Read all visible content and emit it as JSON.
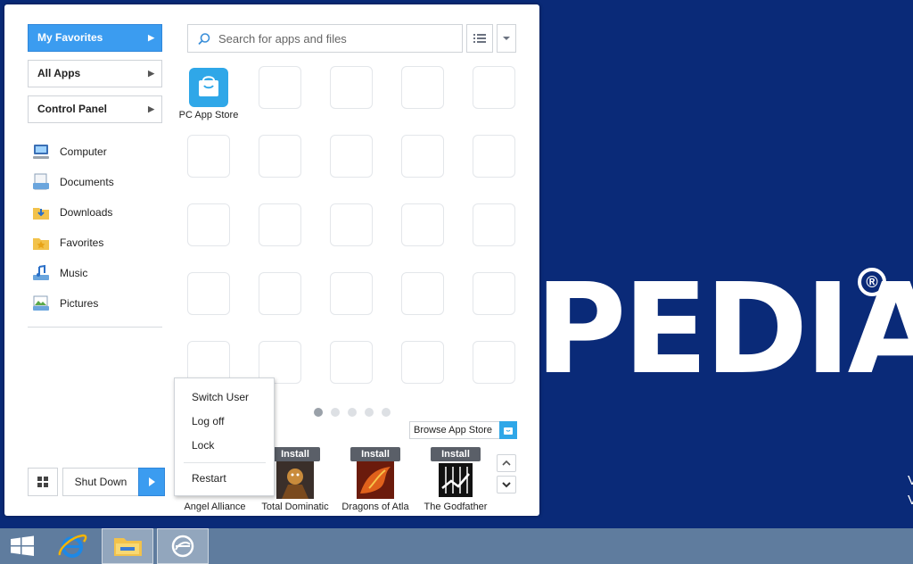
{
  "nav": {
    "favorites": "My Favorites",
    "all_apps": "All Apps",
    "control_panel": "Control Panel"
  },
  "places": [
    "Computer",
    "Documents",
    "Downloads",
    "Favorites",
    "Music",
    "Pictures"
  ],
  "search": {
    "placeholder": "Search for apps and files"
  },
  "apps": {
    "pc_app_store": "PC App Store"
  },
  "browse_store": "Browse App Store",
  "pager": {
    "pages": 5,
    "current": 1
  },
  "games": [
    {
      "name": "Angel Alliance",
      "install": ""
    },
    {
      "name": "Total Dominatic",
      "install": "Install"
    },
    {
      "name": "Dragons of Atla",
      "install": "Install"
    },
    {
      "name": "The Godfather",
      "install": "Install"
    }
  ],
  "power": {
    "shut_down": "Shut Down"
  },
  "power_menu": {
    "switch_user": "Switch User",
    "log_off": "Log off",
    "lock": "Lock",
    "restart": "Restart"
  },
  "wallpaper": {
    "text": "PEDIA",
    "trademark": "®"
  },
  "colors": {
    "accent": "#3b9cf0",
    "desktop": "#0a2a78",
    "taskbar": "#5f7c9e"
  },
  "taskbar_icons": [
    "windows-logo-icon",
    "internet-explorer-icon",
    "file-explorer-icon",
    "start-menu-app-icon"
  ]
}
